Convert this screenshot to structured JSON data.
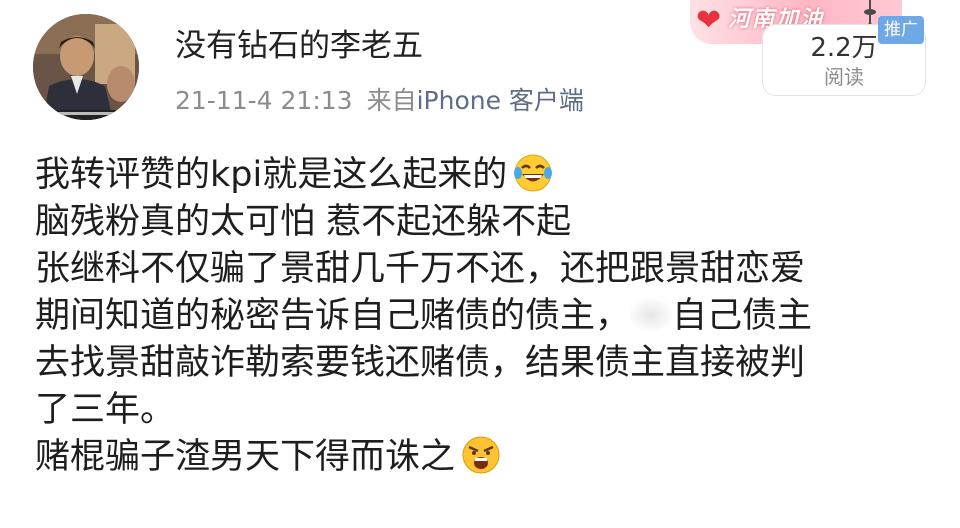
{
  "post": {
    "author": {
      "name": "没有钻石的李老五",
      "avatar": "avatar-photo"
    },
    "time": "21-11-4 21:13",
    "source_prefix": "来自",
    "source_client": "iPhone 客户端",
    "banner_text": "河南加油",
    "promo_tag": "推广",
    "reads": {
      "count": "2.2万",
      "label": "阅读"
    },
    "lines": [
      "我转评赞的kpi就是这么起来的",
      "脑残粉真的太可怕 惹不起还躲不起",
      "张继科不仅骗了景甜几千万不还，还把跟景甜恋爱",
      "期间知道的秘密告诉自己赌债的债主，",
      "自己债主",
      "去找景甜敲诈勒索要钱还赌债，结果债主直接被判",
      "了三年。",
      "赌棍骗子渣男天下得而诛之"
    ],
    "icons": {
      "laugh": "laughing-tears-emoji",
      "angry": "angry-shouting-emoji",
      "heart": "heart-icon",
      "tower": "tv-tower-icon"
    },
    "colors": {
      "text": "#1e1e1e",
      "meta": "#8c8c8c",
      "client_link": "#5d6d86",
      "promo_tag_bg": "#6fa8e6",
      "banner_pink": "#ffb7c4"
    }
  }
}
